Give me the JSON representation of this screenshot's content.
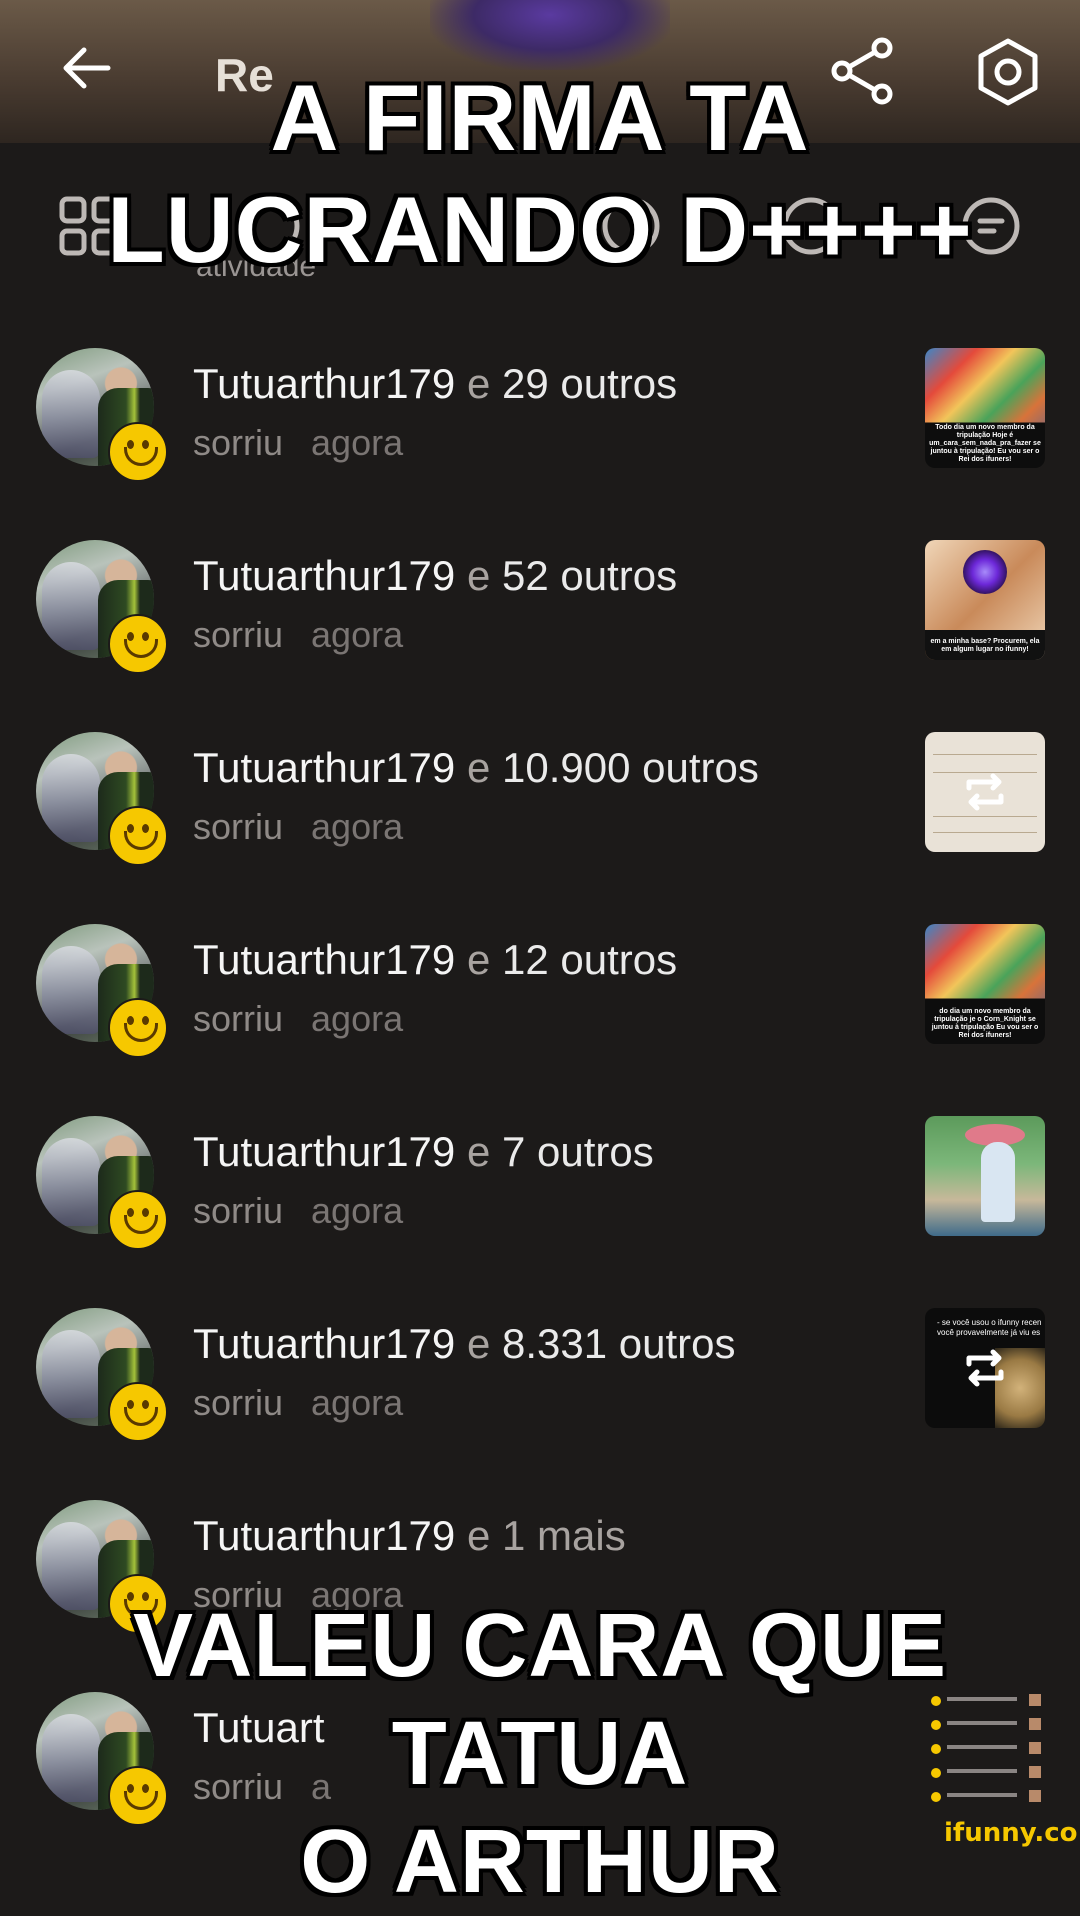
{
  "header": {
    "title": "Re",
    "back_icon": "arrow-left-icon",
    "share_icon": "share-icon",
    "settings_icon": "settings-icon"
  },
  "tabs": {
    "active_label": "atividade",
    "icons": [
      "grid-icon",
      "smile-icon",
      "comment-icon"
    ]
  },
  "rows": [
    {
      "user": "Tutuarthur179",
      "joiner": "e",
      "count": "29 outros",
      "action": "sorriu",
      "time": "agora",
      "thumb": "onepiece",
      "caption": "Todo dia um novo membro da tripulação Hoje é um_cara_sem_nada_pra_fazer se juntou à tripulação! Eu vou ser o Rei dos ifuners!"
    },
    {
      "user": "Tutuarthur179",
      "joiner": "e",
      "count": "52 outros",
      "action": "sorriu",
      "time": "agora",
      "thumb": "cross",
      "caption": "em a minha base? Procurem, ela em algum lugar no ifunny!"
    },
    {
      "user": "Tutuarthur179",
      "joiner": "e",
      "count": "10.900 outros",
      "action": "sorriu",
      "time": "agora",
      "thumb": "paper",
      "caption": ""
    },
    {
      "user": "Tutuarthur179",
      "joiner": "e",
      "count": "12 outros",
      "action": "sorriu",
      "time": "agora",
      "thumb": "onepiece",
      "caption": "do dia um novo membro da tripulação je o Corn_Knight se juntou à tripulação Eu vou ser o Rei dos ifuners!"
    },
    {
      "user": "Tutuarthur179",
      "joiner": "e",
      "count": "7 outros",
      "action": "sorriu",
      "time": "agora",
      "thumb": "anime",
      "caption": ""
    },
    {
      "user": "Tutuarthur179",
      "joiner": "e",
      "count": "8.331 outros",
      "action": "sorriu",
      "time": "agora",
      "thumb": "dark",
      "caption": "- se você usou o ifunny recen você provavelmente já viu es"
    },
    {
      "user": "Tutuarthur179",
      "joiner": "e",
      "count": "1 mais",
      "action": "sorriu",
      "time": "agora",
      "thumb": "none",
      "caption": ""
    },
    {
      "user": "Tutuart",
      "joiner": "",
      "count": "",
      "action": "sorriu",
      "time": "a",
      "thumb": "list",
      "caption": ""
    }
  ],
  "meme": {
    "top_line1": "A FIRMA TA",
    "top_line2": "LUCRANDO D++++",
    "bottom_line1": "VALEU CARA QUE TATUA",
    "bottom_line2": "O ARTHUR"
  },
  "watermark": "ifunny.co",
  "colors": {
    "background": "#1c1a19",
    "smile_badge": "#f6c800",
    "secondary_text": "#8f8a87"
  }
}
